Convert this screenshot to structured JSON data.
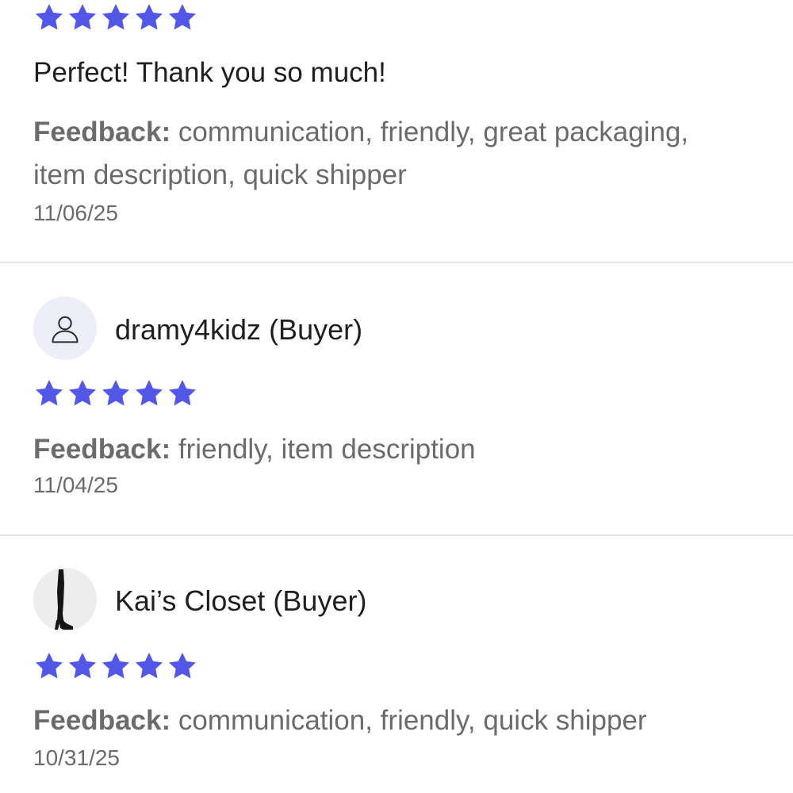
{
  "colors": {
    "star": "#5257e8",
    "divider": "#e6e6e6",
    "muted_text": "#6b6b6b",
    "primary_text": "#1f1f1f"
  },
  "reviews": [
    {
      "rating": 5,
      "comment": "Perfect! Thank you so much!",
      "feedback_label": "Feedback:",
      "feedback_text": "communication, friendly, great packaging, item description, quick shipper",
      "date": "11/06/25"
    },
    {
      "username": "dramy4kidz (Buyer)",
      "avatar_icon": "user-outline-icon",
      "rating": 5,
      "feedback_label": "Feedback:",
      "feedback_text": "friendly, item description",
      "date": "11/04/25"
    },
    {
      "username": "Kai’s Closet (Buyer)",
      "avatar_icon": "boot-photo",
      "rating": 5,
      "feedback_label": "Feedback:",
      "feedback_text": "communication, friendly, quick shipper",
      "date": "10/31/25"
    }
  ]
}
